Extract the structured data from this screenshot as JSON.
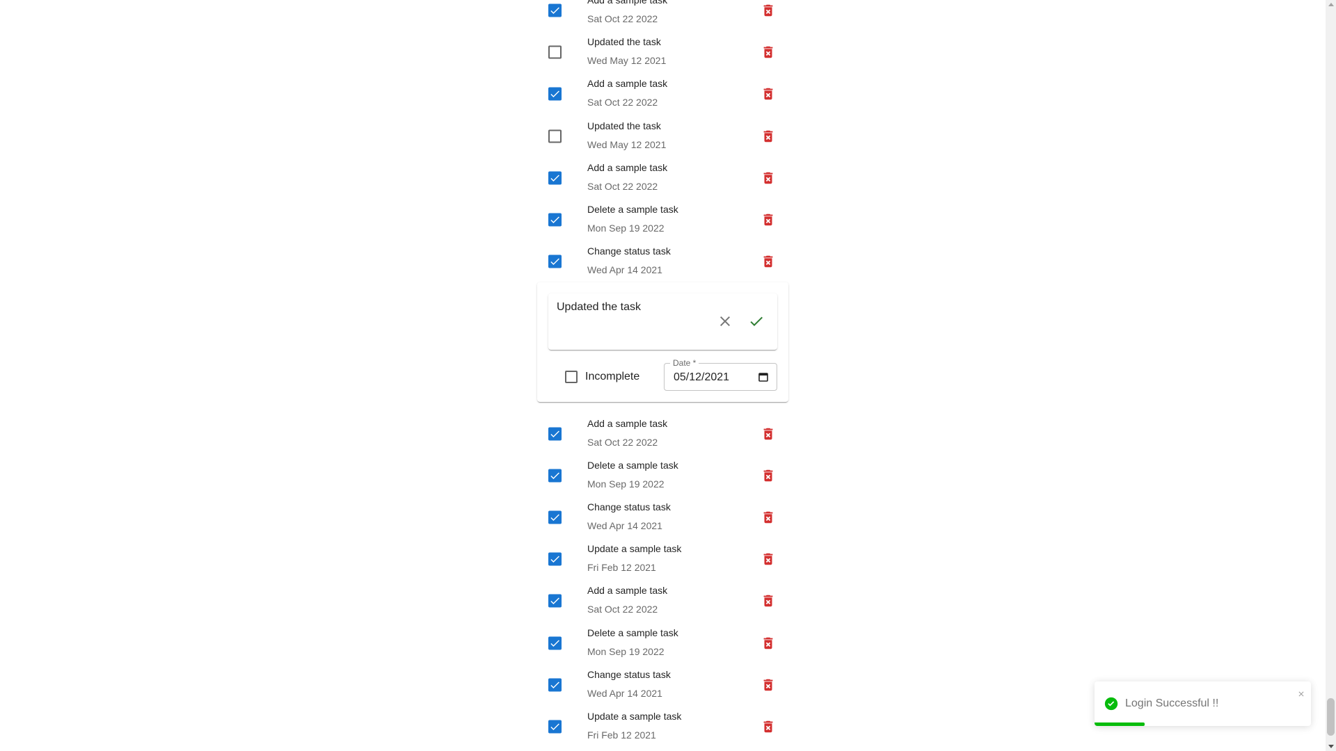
{
  "tasks": [
    {
      "title": "Add a sample task",
      "date": "Sat Oct 22 2022",
      "completed": true
    },
    {
      "title": "Updated the task",
      "date": "Wed May 12 2021",
      "completed": false
    },
    {
      "title": "Add a sample task",
      "date": "Sat Oct 22 2022",
      "completed": true
    },
    {
      "title": "Updated the task",
      "date": "Wed May 12 2021",
      "completed": false
    },
    {
      "title": "Add a sample task",
      "date": "Sat Oct 22 2022",
      "completed": true
    },
    {
      "title": "Delete a sample task",
      "date": "Mon Sep 19 2022",
      "completed": true
    },
    {
      "title": "Change status task",
      "date": "Wed Apr 14 2021",
      "completed": true
    },
    {
      "title": "Add a sample task",
      "date": "Sat Oct 22 2022",
      "completed": true
    },
    {
      "title": "Delete a sample task",
      "date": "Mon Sep 19 2022",
      "completed": true
    },
    {
      "title": "Change status task",
      "date": "Wed Apr 14 2021",
      "completed": true
    },
    {
      "title": "Update a sample task",
      "date": "Fri Feb 12 2021",
      "completed": true
    },
    {
      "title": "Add a sample task",
      "date": "Sat Oct 22 2022",
      "completed": true
    },
    {
      "title": "Delete a sample task",
      "date": "Mon Sep 19 2022",
      "completed": true
    },
    {
      "title": "Change status task",
      "date": "Wed Apr 14 2021",
      "completed": true
    },
    {
      "title": "Update a sample task",
      "date": "Fri Feb 12 2021",
      "completed": true
    }
  ],
  "edit_card": {
    "text": "Updated the task",
    "status_label": "Incomplete",
    "status_checked": false,
    "date_label": "Date *",
    "date_value": "05/12/2021"
  },
  "toast": {
    "message": "Login Successful !!",
    "progress": 0.23
  },
  "colors": {
    "checkbox_checked": "#1976d2",
    "delete_icon": "#d32f2f",
    "confirm_icon": "#2e7d32",
    "toast_success": "#07bc0c"
  },
  "icons": {
    "delete": "delete-forever-icon",
    "cancel": "close-icon",
    "confirm": "check-icon",
    "calendar": "calendar-icon",
    "toast": "check-circle-icon",
    "toast_close": "close-icon"
  }
}
